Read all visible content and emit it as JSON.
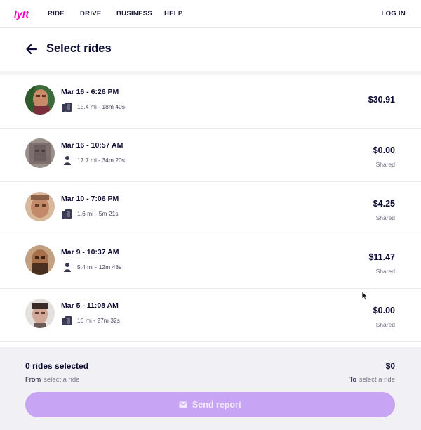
{
  "nav": {
    "logo": "lyft",
    "links": [
      "RIDE",
      "DRIVE",
      "BUSINESS",
      "HELP"
    ],
    "login": "LOG IN",
    "brand_color": "#ff00bf"
  },
  "header": {
    "back_icon": "arrow-left-icon",
    "title": "Select rides"
  },
  "rides": [
    {
      "date": "Mar 16 - 6:26 PM",
      "meta": "15.4 mi - 18m 40s",
      "price": "$30.91",
      "tag": "",
      "type_icon": "car-seat-icon"
    },
    {
      "date": "Mar 16 - 10:57 AM",
      "meta": "17.7 mi - 34m 20s",
      "price": "$0.00",
      "tag": "Shared",
      "type_icon": "person-icon"
    },
    {
      "date": "Mar 10 - 7:06 PM",
      "meta": "1.6 mi - 5m 21s",
      "price": "$4.25",
      "tag": "Shared",
      "type_icon": "car-seat-icon"
    },
    {
      "date": "Mar 9 - 10:37 AM",
      "meta": "5.4 mi - 12m 48s",
      "price": "$11.47",
      "tag": "Shared",
      "type_icon": "person-icon"
    },
    {
      "date": "Mar 5 - 11:08 AM",
      "meta": "16 mi - 27m 32s",
      "price": "$0.00",
      "tag": "Shared",
      "type_icon": "car-seat-icon"
    }
  ],
  "footer": {
    "selected_count": "0 rides selected",
    "total": "$0",
    "from_label": "From",
    "from_value": "select a ride",
    "to_label": "To",
    "to_value": "select a ride",
    "send_label": "Send report",
    "send_icon": "mail-icon",
    "button_color": "#c8a5f4"
  }
}
